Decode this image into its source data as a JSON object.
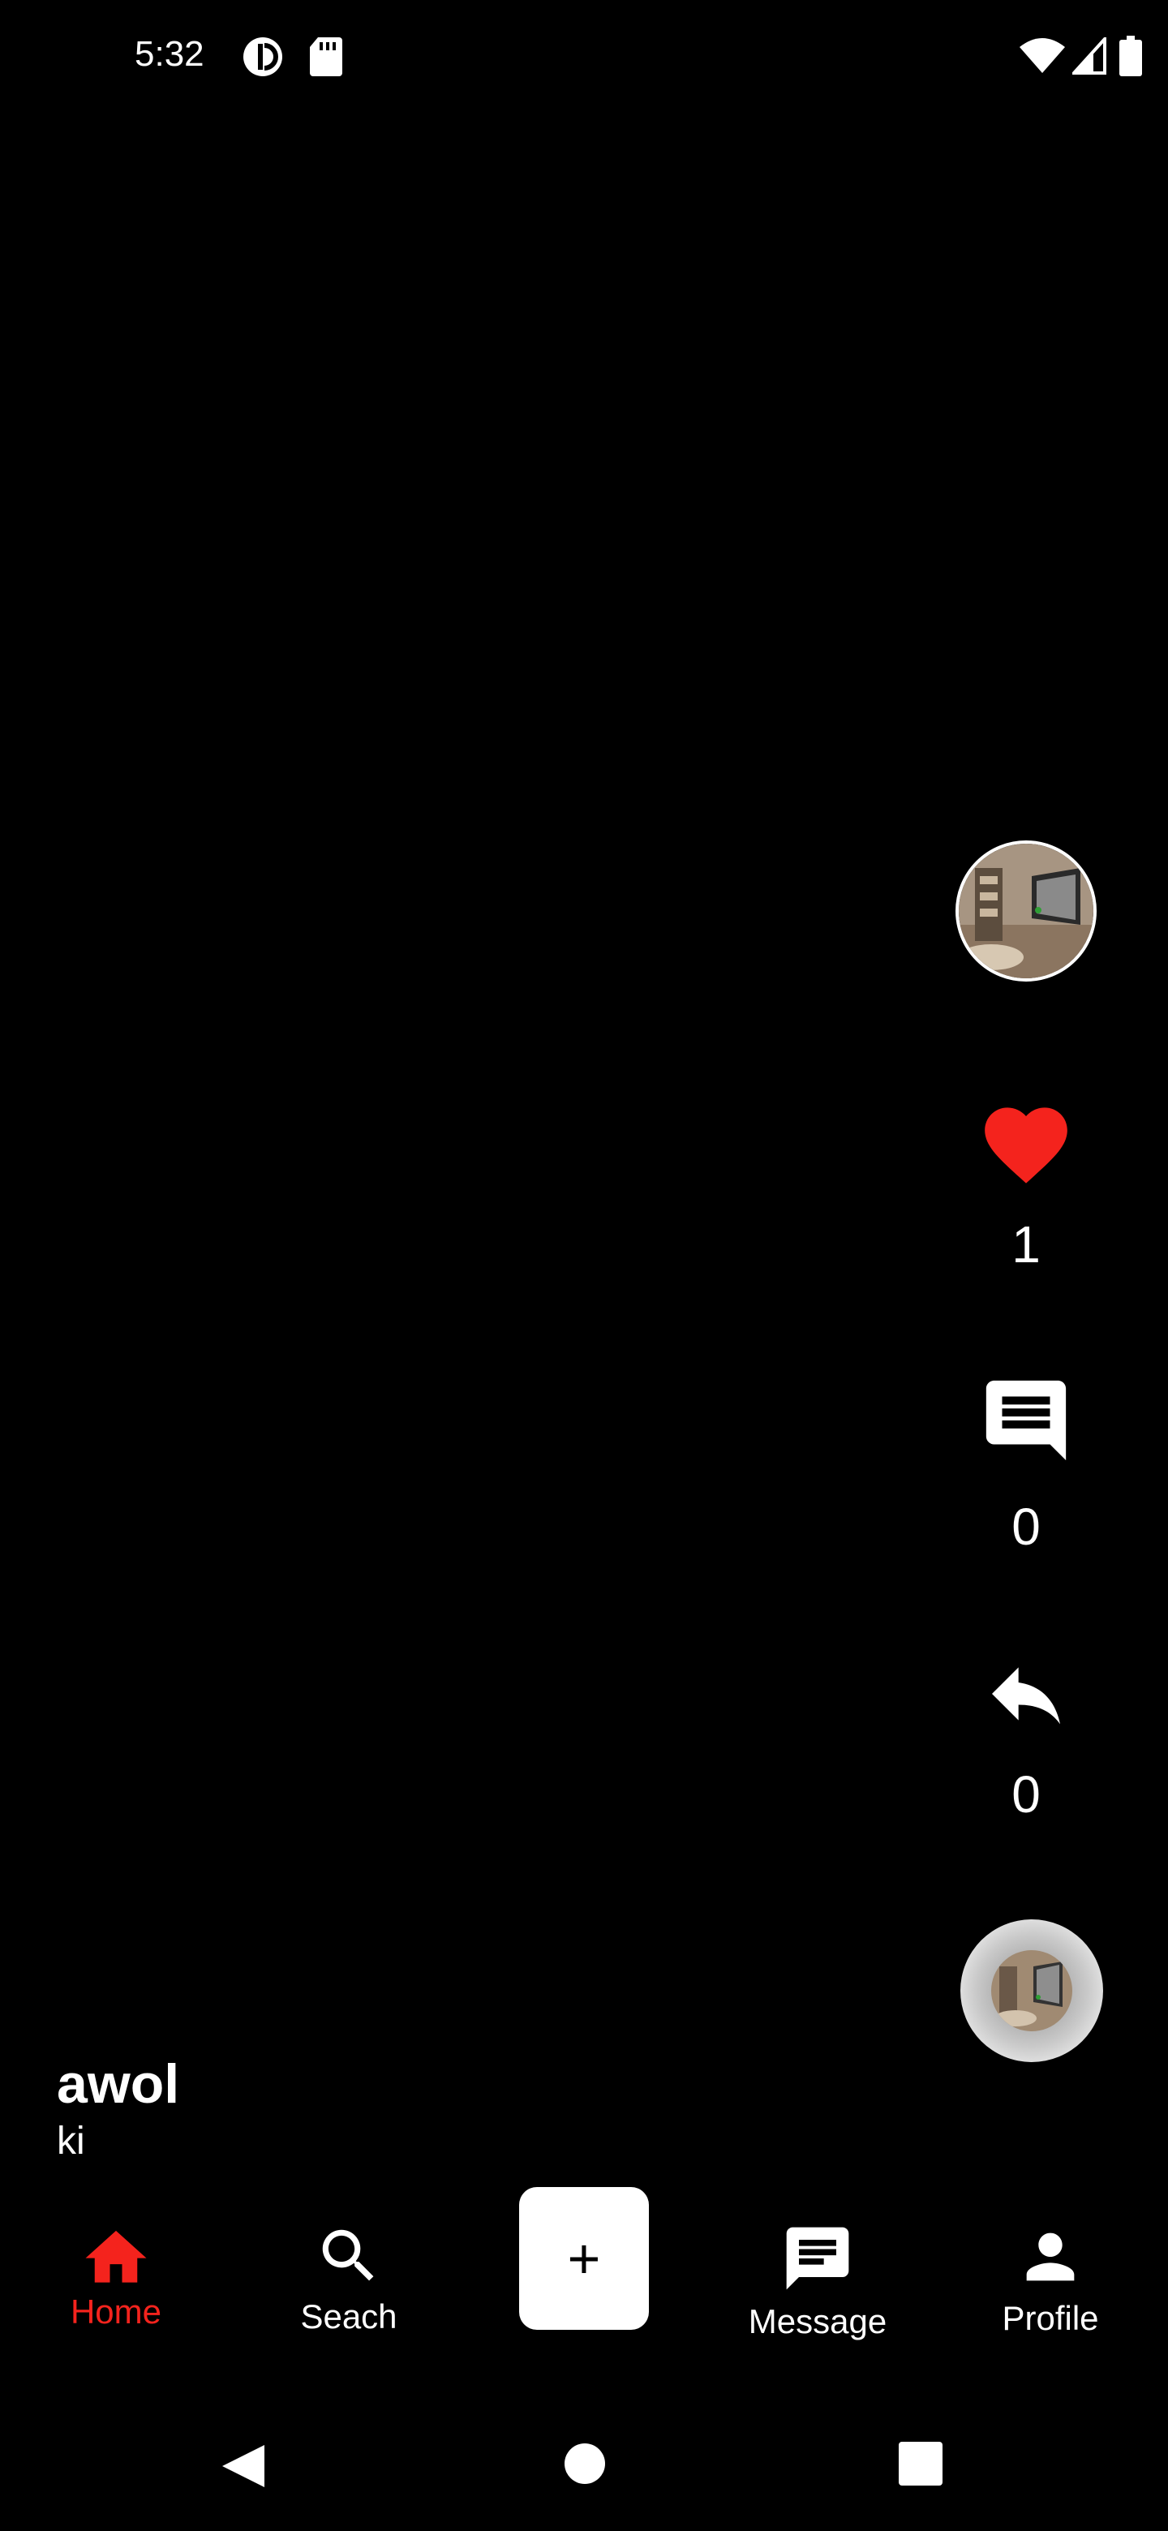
{
  "status_bar": {
    "time": "5:32",
    "left_icons": [
      "ring-app-icon",
      "sd-card-icon"
    ],
    "right_icons": [
      "wifi-icon",
      "cellular-signal-icon",
      "battery-icon"
    ]
  },
  "actions": {
    "creator_avatar_icon": "avatar",
    "like": {
      "icon": "heart-icon",
      "count": "1",
      "color": "#f4231d"
    },
    "comment": {
      "icon": "comment-icon",
      "count": "0"
    },
    "share": {
      "icon": "share-reply-icon",
      "count": "0"
    },
    "music_disc_icon": "music-disc"
  },
  "post": {
    "username": "awol",
    "caption": "ki"
  },
  "bottom_nav": {
    "items": [
      {
        "label": "Home",
        "icon": "home-icon",
        "active": true
      },
      {
        "label": "Seach",
        "icon": "search-icon",
        "active": false
      },
      {
        "label": "+",
        "icon": "plus-icon",
        "active": false
      },
      {
        "label": "Message",
        "icon": "message-icon",
        "active": false
      },
      {
        "label": "Profile",
        "icon": "person-icon",
        "active": false
      }
    ]
  },
  "colors": {
    "background": "#000000",
    "accent": "#f4231d",
    "text": "#ffffff"
  }
}
